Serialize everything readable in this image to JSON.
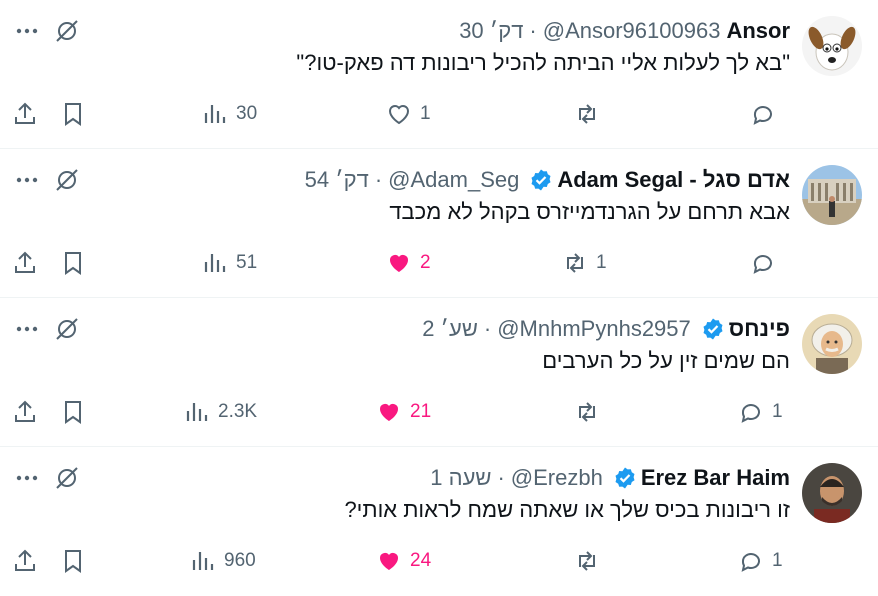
{
  "tweets": [
    {
      "name": "Ansor",
      "verified": false,
      "handle": "@Ansor96100963",
      "time": "30 דק׳",
      "text": "\"בא לך לעלות אליי הביתה להכיל ריבונות דה פאק-טו?\"",
      "views": "30",
      "likes": "1",
      "liked": false,
      "retweets": "",
      "replies": ""
    },
    {
      "name": "Adam Segal - אדם סגל",
      "verified": true,
      "handle": "@Adam_Seg",
      "time": "54 דק׳",
      "text": "אבא תרחם על הגרנדמייזרס בקהל לא מכבד",
      "views": "51",
      "likes": "2",
      "liked": true,
      "retweets": "1",
      "replies": ""
    },
    {
      "name": "פינחס",
      "verified": true,
      "handle": "@MnhmPynhs2957",
      "time": "2 שע׳",
      "text": "הם שמים זין על כל הערבים",
      "views": "2.3K",
      "likes": "21",
      "liked": true,
      "retweets": "",
      "replies": "1"
    },
    {
      "name": "Erez Bar Haim",
      "verified": true,
      "handle": "@Erezbh",
      "time": "1 שעה",
      "text": "זו ריבונות בכיס שלך או שאתה שמח לראות אותי?",
      "views": "960",
      "likes": "24",
      "liked": true,
      "retweets": "",
      "replies": "1"
    }
  ],
  "colors": {
    "text": "#0f1419",
    "secondary": "#536471",
    "like": "#f91880",
    "verified": "#1d9bf0",
    "divider": "#eff3f4"
  },
  "icons": [
    "more-icon",
    "grok-icon",
    "share-icon",
    "bookmark-icon",
    "views-icon",
    "like-icon",
    "retweet-icon",
    "reply-icon",
    "verified-badge-icon"
  ]
}
